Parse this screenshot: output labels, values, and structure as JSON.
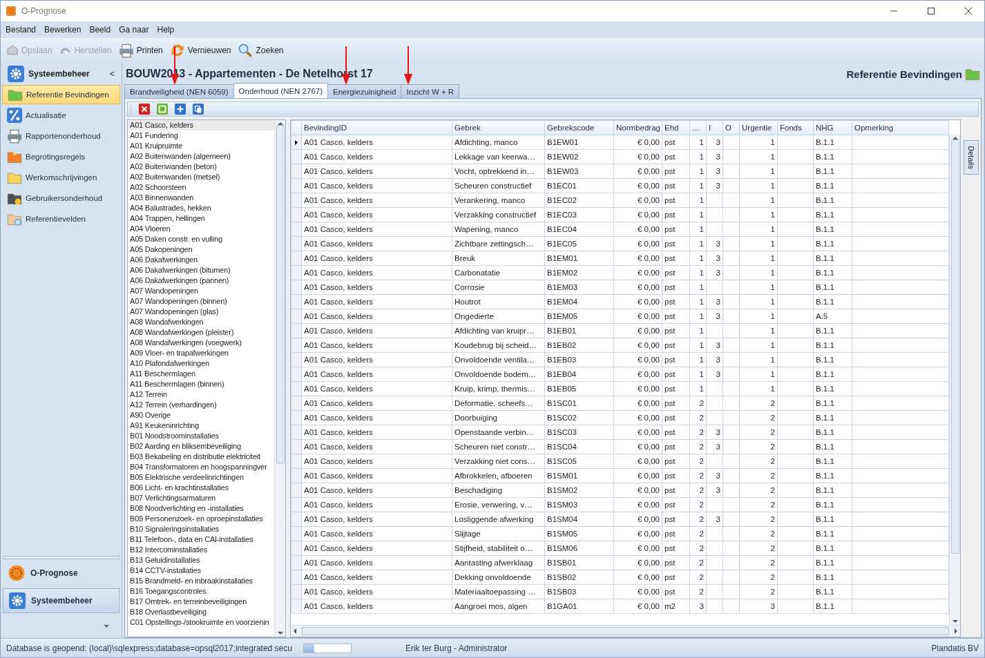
{
  "window": {
    "title": "O-Prognose"
  },
  "menu": [
    "Bestand",
    "Bewerken",
    "Beeld",
    "Ga naar",
    "Help"
  ],
  "toolbar": [
    {
      "label": "Opslaan",
      "kind": "save",
      "disabled": true
    },
    {
      "label": "Herstellen",
      "kind": "undo",
      "disabled": true
    },
    {
      "label": "Printen",
      "kind": "print",
      "disabled": false
    },
    {
      "label": "Vernieuwen",
      "kind": "refresh",
      "disabled": false
    },
    {
      "label": "Zoeken",
      "kind": "search",
      "disabled": false
    }
  ],
  "sidebar": {
    "header": "Systeembeheer",
    "collapse": "<",
    "items": [
      {
        "label": "Referentie Bevindingen",
        "kind": "folder-green",
        "selected": true
      },
      {
        "label": "Actualisatie",
        "kind": "percent",
        "selected": false
      },
      {
        "label": "Rapportenonderhoud",
        "kind": "printer",
        "selected": false
      },
      {
        "label": "Begrotingsregels",
        "kind": "folder-orange",
        "selected": false
      },
      {
        "label": "Werkomschrijvingen",
        "kind": "folder-yellow",
        "selected": false
      },
      {
        "label": "Gebruikersonderhoud",
        "kind": "folder-lock",
        "selected": false
      },
      {
        "label": "Referentievelden",
        "kind": "folder-search",
        "selected": false
      }
    ],
    "modules": [
      {
        "label": "O-Prognose",
        "kind": "prognose",
        "selected": false
      },
      {
        "label": "Systeembeheer",
        "kind": "gear",
        "selected": true
      }
    ]
  },
  "project_title": "BOUW2013 - Appartementen - De Netelhorst 17",
  "page_title": "Referentie Bevindingen",
  "tabs": [
    {
      "label": "Brandveiligheid (NEN 6059)",
      "selected": false
    },
    {
      "label": "Onderhoud (NEN 2767)",
      "selected": true
    },
    {
      "label": "Energiezuinigheid",
      "selected": false
    },
    {
      "label": "Inzicht W + R",
      "selected": false
    }
  ],
  "panel_tools": [
    {
      "kind": "delete"
    },
    {
      "kind": "window"
    },
    {
      "kind": "add"
    },
    {
      "kind": "copy"
    }
  ],
  "categories": [
    {
      "label": "A01 Casco, kelders",
      "selected": true
    },
    {
      "label": "A01 Fundering",
      "selected": false
    },
    {
      "label": "A01 Kruipruimte",
      "selected": false
    },
    {
      "label": "A02 Buitenwanden (algemeen)",
      "selected": false
    },
    {
      "label": "A02 Buitenwanden (beton)",
      "selected": false
    },
    {
      "label": "A02 Buitenwanden (metsel)",
      "selected": false
    },
    {
      "label": "A02 Schoorsteen",
      "selected": false
    },
    {
      "label": "A03 Binnenwanden",
      "selected": false
    },
    {
      "label": "A04 Balustrades, hekken",
      "selected": false
    },
    {
      "label": "A04 Trappen, hellingen",
      "selected": false
    },
    {
      "label": "A04 Vloeren",
      "selected": false
    },
    {
      "label": "A05 Daken constr. en vulling",
      "selected": false
    },
    {
      "label": "A05 Dakopeningen",
      "selected": false
    },
    {
      "label": "A06 Dakafwerkingen",
      "selected": false
    },
    {
      "label": "A06 Dakafwerkingen (bitumen)",
      "selected": false
    },
    {
      "label": "A06 Dakafwerkingen (pannen)",
      "selected": false
    },
    {
      "label": "A07 Wandopeningen",
      "selected": false
    },
    {
      "label": "A07 Wandopeningen (binnen)",
      "selected": false
    },
    {
      "label": "A07 Wandopeningen (glas)",
      "selected": false
    },
    {
      "label": "A08 Wandafwerkingen",
      "selected": false
    },
    {
      "label": "A08 Wandafwerkingen (pleister)",
      "selected": false
    },
    {
      "label": "A08 Wandafwerkingen (voegwerk)",
      "selected": false
    },
    {
      "label": "A09 Vloer- en trapafwerkingen",
      "selected": false
    },
    {
      "label": "A10 Plafondafwerkingen",
      "selected": false
    },
    {
      "label": "A11 Beschermlagen",
      "selected": false
    },
    {
      "label": "A11 Beschermlagen (binnen)",
      "selected": false
    },
    {
      "label": "A12 Terrein",
      "selected": false
    },
    {
      "label": "A12 Terrein (verhardingen)",
      "selected": false
    },
    {
      "label": "A90 Overige",
      "selected": false
    },
    {
      "label": "A91 Keukeninrichting",
      "selected": false
    },
    {
      "label": "B01 Noodstroominstallaties",
      "selected": false
    },
    {
      "label": "B02 Aarding en bliksembeveiliging",
      "selected": false
    },
    {
      "label": "B03 Bekabeling en distributie elektriciteit",
      "selected": false
    },
    {
      "label": "B04 Transformatoren en hoogspanningver",
      "selected": false
    },
    {
      "label": "B05 Elektrische verdeelinrichtingen",
      "selected": false
    },
    {
      "label": "B06 Licht- en krachtinstallaties",
      "selected": false
    },
    {
      "label": "B07 Verlichtingsarmaturen",
      "selected": false
    },
    {
      "label": "B08 Noodverlichting en -installaties",
      "selected": false
    },
    {
      "label": "B09 Personenzoek- en oproepinstallaties",
      "selected": false
    },
    {
      "label": "B10 Signaleringsinstallaties",
      "selected": false
    },
    {
      "label": "B11 Telefoon-, data en CAI-installaties",
      "selected": false
    },
    {
      "label": "B12 Intercominstallaties",
      "selected": false
    },
    {
      "label": "B13 Geluidinstallaties",
      "selected": false
    },
    {
      "label": "B14 CCTV-installaties",
      "selected": false
    },
    {
      "label": "B15 Brandmeld- en inbraakinstallaties",
      "selected": false
    },
    {
      "label": "B16 Toegangscontroles",
      "selected": false
    },
    {
      "label": "B17 Omtrek- en terreinbeveiligingen",
      "selected": false
    },
    {
      "label": "B18 Overlastbeveiliging",
      "selected": false
    },
    {
      "label": "C01 Opstellings-/stookruimte en voorzienin",
      "selected": false
    }
  ],
  "table": {
    "columns": [
      "BevindingID",
      "Gebrek",
      "Gebrekscode",
      "Normbedrag",
      "Ehd",
      "…",
      "I",
      "O",
      "Urgentie",
      "Fonds",
      "NHG",
      "Opmerking"
    ],
    "rows": [
      {
        "current": true,
        "cells": [
          "A01 Casco, kelders",
          "Afdichting, manco",
          "B1EW01",
          "€ 0,00",
          "pst",
          "1",
          "3",
          "",
          "1",
          "",
          "B.1.1",
          ""
        ]
      },
      {
        "current": false,
        "cells": [
          "A01 Casco, kelders",
          "Lekkage van keerwa…",
          "B1EW02",
          "€ 0,00",
          "pst",
          "1",
          "3",
          "",
          "1",
          "",
          "B.1.1",
          ""
        ]
      },
      {
        "current": false,
        "cells": [
          "A01 Casco, kelders",
          "Vocht, optrekkend in…",
          "B1EW03",
          "€ 0,00",
          "pst",
          "1",
          "3",
          "",
          "1",
          "",
          "B.1.1",
          ""
        ]
      },
      {
        "current": false,
        "cells": [
          "A01 Casco, kelders",
          "Scheuren constructief",
          "B1EC01",
          "€ 0,00",
          "pst",
          "1",
          "3",
          "",
          "1",
          "",
          "B.1.1",
          ""
        ]
      },
      {
        "current": false,
        "cells": [
          "A01 Casco, kelders",
          "Verankering, manco",
          "B1EC02",
          "€ 0,00",
          "pst",
          "1",
          "",
          "",
          "1",
          "",
          "B.1.1",
          ""
        ]
      },
      {
        "current": false,
        "cells": [
          "A01 Casco, kelders",
          "Verzakking constructief",
          "B1EC03",
          "€ 0,00",
          "pst",
          "1",
          "",
          "",
          "1",
          "",
          "B.1.1",
          ""
        ]
      },
      {
        "current": false,
        "cells": [
          "A01 Casco, kelders",
          "Wapening, manco",
          "B1EC04",
          "€ 0,00",
          "pst",
          "1",
          "",
          "",
          "1",
          "",
          "B.1.1",
          ""
        ]
      },
      {
        "current": false,
        "cells": [
          "A01 Casco, kelders",
          "Zichtbare zettingsch…",
          "B1EC05",
          "€ 0,00",
          "pst",
          "1",
          "3",
          "",
          "1",
          "",
          "B.1.1",
          ""
        ]
      },
      {
        "current": false,
        "cells": [
          "A01 Casco, kelders",
          "Breuk",
          "B1EM01",
          "€ 0,00",
          "pst",
          "1",
          "3",
          "",
          "1",
          "",
          "B.1.1",
          ""
        ]
      },
      {
        "current": false,
        "cells": [
          "A01 Casco, kelders",
          "Carbonatatie",
          "B1EM02",
          "€ 0,00",
          "pst",
          "1",
          "3",
          "",
          "1",
          "",
          "B.1.1",
          ""
        ]
      },
      {
        "current": false,
        "cells": [
          "A01 Casco, kelders",
          "Corrosie",
          "B1EM03",
          "€ 0,00",
          "pst",
          "1",
          "",
          "",
          "1",
          "",
          "B.1.1",
          ""
        ]
      },
      {
        "current": false,
        "cells": [
          "A01 Casco, kelders",
          "Houtrot",
          "B1EM04",
          "€ 0,00",
          "pst",
          "1",
          "3",
          "",
          "1",
          "",
          "B.1.1",
          ""
        ]
      },
      {
        "current": false,
        "cells": [
          "A01 Casco, kelders",
          "Ongedierte",
          "B1EM05",
          "€ 0,00",
          "pst",
          "1",
          "3",
          "",
          "1",
          "",
          "A.5",
          ""
        ]
      },
      {
        "current": false,
        "cells": [
          "A01 Casco, kelders",
          "Afdichting van kruipr…",
          "B1EB01",
          "€ 0,00",
          "pst",
          "1",
          "",
          "",
          "1",
          "",
          "B.1.1",
          ""
        ]
      },
      {
        "current": false,
        "cells": [
          "A01 Casco, kelders",
          "Koudebrug bij scheid…",
          "B1EB02",
          "€ 0,00",
          "pst",
          "1",
          "3",
          "",
          "1",
          "",
          "B.1.1",
          ""
        ]
      },
      {
        "current": false,
        "cells": [
          "A01 Casco, kelders",
          "Onvoldoende ventila…",
          "B1EB03",
          "€ 0,00",
          "pst",
          "1",
          "3",
          "",
          "1",
          "",
          "B.1.1",
          ""
        ]
      },
      {
        "current": false,
        "cells": [
          "A01 Casco, kelders",
          "Onvoldoende bodem…",
          "B1EB04",
          "€ 0,00",
          "pst",
          "1",
          "3",
          "",
          "1",
          "",
          "B.1.1",
          ""
        ]
      },
      {
        "current": false,
        "cells": [
          "A01 Casco, kelders",
          "Kruip, krimp, thermis…",
          "B1EB05",
          "€ 0,00",
          "pst",
          "1",
          "",
          "",
          "1",
          "",
          "B.1.1",
          ""
        ]
      },
      {
        "current": false,
        "cells": [
          "A01 Casco, kelders",
          "Deformatie, scheefs…",
          "B1SC01",
          "€ 0,00",
          "pst",
          "2",
          "",
          "",
          "2",
          "",
          "B.1.1",
          ""
        ]
      },
      {
        "current": false,
        "cells": [
          "A01 Casco, kelders",
          "Doorbuiging",
          "B1SC02",
          "€ 0,00",
          "pst",
          "2",
          "",
          "",
          "2",
          "",
          "B.1.1",
          ""
        ]
      },
      {
        "current": false,
        "cells": [
          "A01 Casco, kelders",
          "Openstaande verbin…",
          "B1SC03",
          "€ 0,00",
          "pst",
          "2",
          "3",
          "",
          "2",
          "",
          "B.1.1",
          ""
        ]
      },
      {
        "current": false,
        "cells": [
          "A01 Casco, kelders",
          "Scheuren niet constr…",
          "B1SC04",
          "€ 0,00",
          "pst",
          "2",
          "3",
          "",
          "2",
          "",
          "B.1.1",
          ""
        ]
      },
      {
        "current": false,
        "cells": [
          "A01 Casco, kelders",
          "Verzakking niet cons…",
          "B1SC05",
          "€ 0,00",
          "pst",
          "2",
          "",
          "",
          "2",
          "",
          "B.1.1",
          ""
        ]
      },
      {
        "current": false,
        "cells": [
          "A01 Casco, kelders",
          "Afbrokkelen, afboeren",
          "B1SM01",
          "€ 0,00",
          "pst",
          "2",
          "3",
          "",
          "2",
          "",
          "B.1.1",
          ""
        ]
      },
      {
        "current": false,
        "cells": [
          "A01 Casco, kelders",
          "Beschadiging",
          "B1SM02",
          "€ 0,00",
          "pst",
          "2",
          "3",
          "",
          "2",
          "",
          "B.1.1",
          ""
        ]
      },
      {
        "current": false,
        "cells": [
          "A01 Casco, kelders",
          "Erosie, verwering, v…",
          "B1SM03",
          "€ 0,00",
          "pst",
          "2",
          "",
          "",
          "2",
          "",
          "B.1.1",
          ""
        ]
      },
      {
        "current": false,
        "cells": [
          "A01 Casco, kelders",
          "Losliggende afwerking",
          "B1SM04",
          "€ 0,00",
          "pst",
          "2",
          "3",
          "",
          "2",
          "",
          "B.1.1",
          ""
        ]
      },
      {
        "current": false,
        "cells": [
          "A01 Casco, kelders",
          "Slijtage",
          "B1SM05",
          "€ 0,00",
          "pst",
          "2",
          "",
          "",
          "2",
          "",
          "B.1.1",
          ""
        ]
      },
      {
        "current": false,
        "cells": [
          "A01 Casco, kelders",
          "Stijfheid, stabiliteit o…",
          "B1SM06",
          "€ 0,00",
          "pst",
          "2",
          "",
          "",
          "2",
          "",
          "B.1.1",
          ""
        ]
      },
      {
        "current": false,
        "cells": [
          "A01 Casco, kelders",
          "Aantasting afwerklaag",
          "B1SB01",
          "€ 0,00",
          "pst",
          "2",
          "",
          "",
          "2",
          "",
          "B.1.1",
          ""
        ]
      },
      {
        "current": false,
        "cells": [
          "A01 Casco, kelders",
          "Dekking onvoldoende",
          "B1SB02",
          "€ 0,00",
          "pst",
          "2",
          "",
          "",
          "2",
          "",
          "B.1.1",
          ""
        ]
      },
      {
        "current": false,
        "cells": [
          "A01 Casco, kelders",
          "Materiaaltoepassing …",
          "B1SB03",
          "€ 0,00",
          "pst",
          "2",
          "",
          "",
          "2",
          "",
          "B.1.1",
          ""
        ]
      },
      {
        "current": false,
        "cells": [
          "A01 Casco, kelders",
          "Aangroei mos, algen",
          "B1GA01",
          "€ 0,00",
          "m2",
          "3",
          "",
          "",
          "3",
          "",
          "B.1.1",
          ""
        ]
      }
    ]
  },
  "details_tab": "Details",
  "status_bar": {
    "connection": "Database is geopend: (local)\\sqlexpress;database=opsql2017;integrated secu",
    "progress": {
      "level": 0.22
    },
    "user": "Erik ter Burg - Administrator",
    "company": "Plandatis BV"
  }
}
